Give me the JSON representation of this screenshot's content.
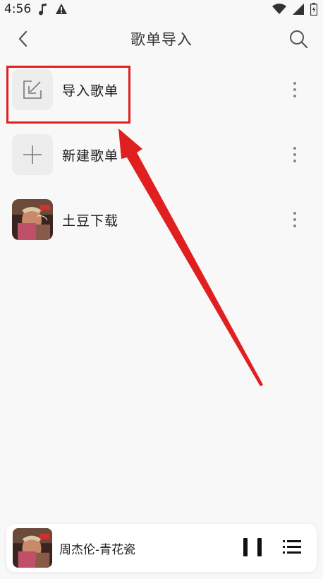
{
  "status_bar": {
    "time": "4:56"
  },
  "header": {
    "title": "歌单导入"
  },
  "list": [
    {
      "label": "导入歌单",
      "icon": "import-icon"
    },
    {
      "label": "新建歌单",
      "icon": "plus-icon"
    },
    {
      "label": "土豆下载",
      "icon": "album-cover"
    }
  ],
  "player": {
    "track": "周杰伦-青花瓷"
  },
  "colors": {
    "highlight": "#e02020",
    "background": "#f8f8f8",
    "thumb_bg": "#ededed"
  }
}
